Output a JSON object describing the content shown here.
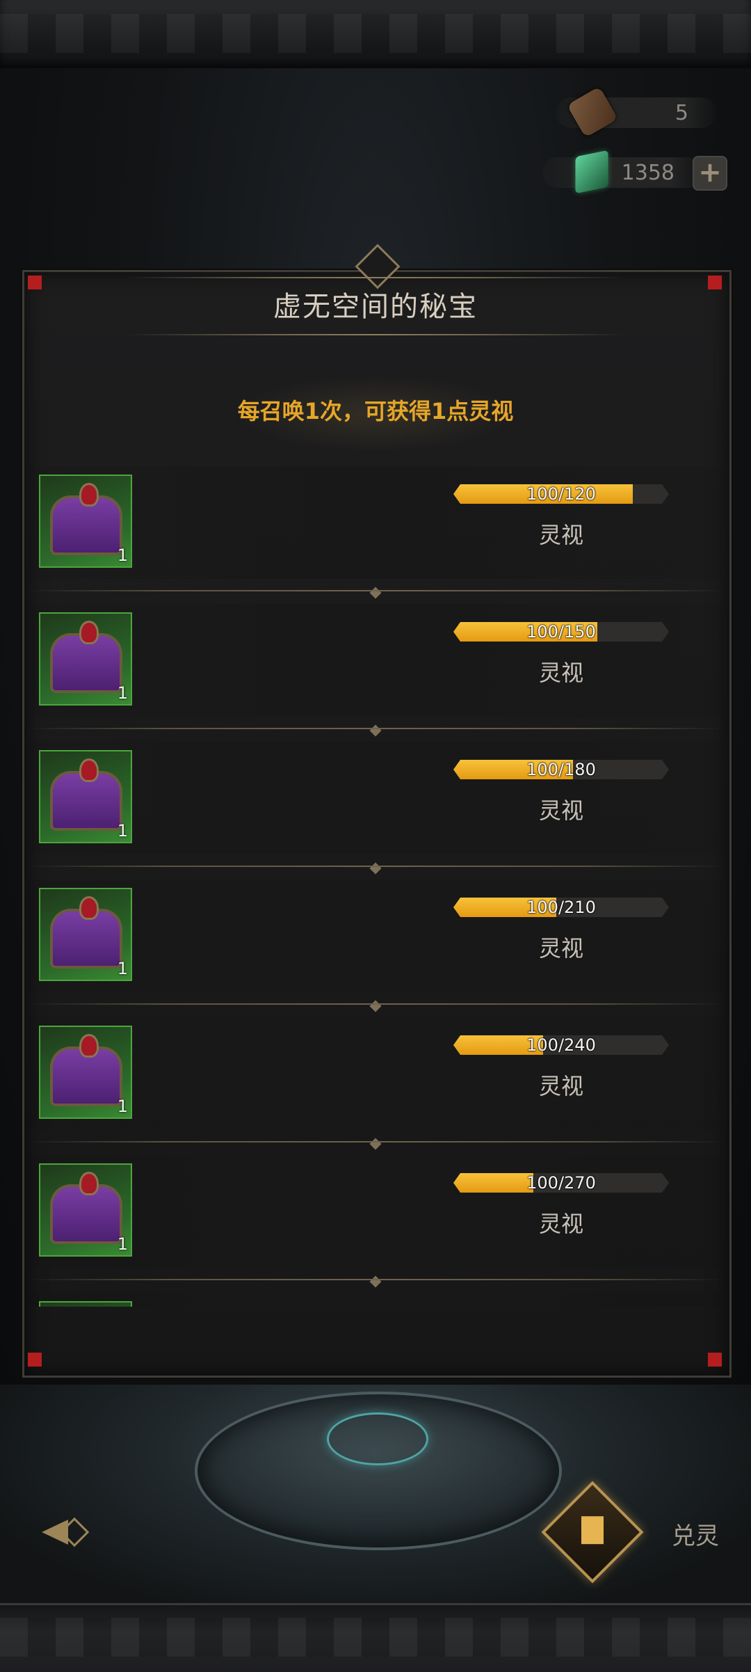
{
  "header": {
    "currencies": [
      {
        "icon": "scroll-icon",
        "value": "5"
      },
      {
        "icon": "green-gem-icon",
        "value": "1358"
      }
    ],
    "add_label": "+"
  },
  "panel": {
    "title": "虚无空间的秘宝",
    "subtitle": "每召唤1次，可获得1点灵视"
  },
  "rewards": [
    {
      "progress_text": "100/120",
      "progress": 0.8333,
      "reward_label": "灵视",
      "item_count": "1"
    },
    {
      "progress_text": "100/150",
      "progress": 0.6667,
      "reward_label": "灵视",
      "item_count": "1"
    },
    {
      "progress_text": "100/180",
      "progress": 0.5556,
      "reward_label": "灵视",
      "item_count": "1"
    },
    {
      "progress_text": "100/210",
      "progress": 0.4762,
      "reward_label": "灵视",
      "item_count": "1"
    },
    {
      "progress_text": "100/240",
      "progress": 0.4167,
      "reward_label": "灵视",
      "item_count": "1"
    },
    {
      "progress_text": "100/270",
      "progress": 0.3704,
      "reward_label": "灵视",
      "item_count": "1"
    }
  ],
  "footer": {
    "exchange_label": "兑灵"
  },
  "colors": {
    "accent_gold": "#e6a629",
    "progress_fill": "#f2b528",
    "corner_red": "#b51e1e",
    "item_frame_green": "#4ca63d"
  }
}
